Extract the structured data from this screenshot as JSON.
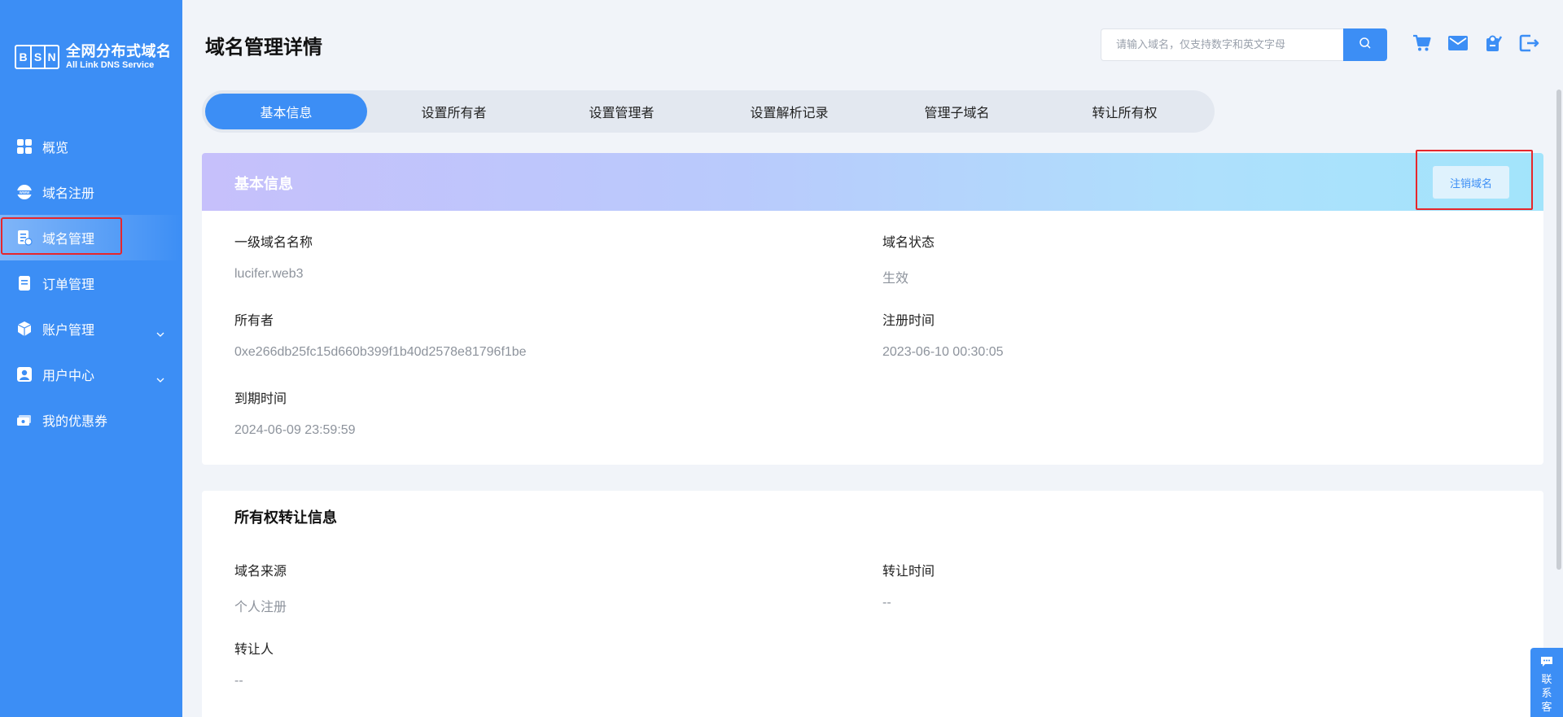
{
  "app": {
    "logo_letters": [
      "B",
      "S",
      "N"
    ],
    "logo_cn": "全网分布式域名",
    "logo_en": "All Link DNS Service"
  },
  "sidebar": {
    "items": [
      {
        "label": "概览",
        "icon": "grid-icon",
        "active": false
      },
      {
        "label": "域名注册",
        "icon": "www-icon",
        "active": false
      },
      {
        "label": "域名管理",
        "icon": "domain-manage-icon",
        "active": true
      },
      {
        "label": "订单管理",
        "icon": "order-icon",
        "active": false
      },
      {
        "label": "账户管理",
        "icon": "account-icon",
        "active": false,
        "expandable": true
      },
      {
        "label": "用户中心",
        "icon": "user-icon",
        "active": false,
        "expandable": true
      },
      {
        "label": "我的优惠券",
        "icon": "coupon-icon",
        "active": false
      }
    ]
  },
  "header": {
    "title": "域名管理详情",
    "search_placeholder": "请输入域名，仅支持数字和英文字母",
    "icons": [
      "cart-icon",
      "mail-icon",
      "certificate-icon",
      "logout-icon"
    ]
  },
  "tabs": [
    {
      "label": "基本信息",
      "active": true
    },
    {
      "label": "设置所有者",
      "active": false
    },
    {
      "label": "设置管理者",
      "active": false
    },
    {
      "label": "设置解析记录",
      "active": false
    },
    {
      "label": "管理子域名",
      "active": false
    },
    {
      "label": "转让所有权",
      "active": false
    }
  ],
  "basic_info": {
    "title": "基本信息",
    "cancel_button": "注销域名",
    "domain_name_label": "一级域名名称",
    "domain_name": "lucifer.web3",
    "status_label": "域名状态",
    "status": "生效",
    "owner_label": "所有者",
    "owner": "0xe266db25fc15d660b399f1b40d2578e81796f1be",
    "register_time_label": "注册时间",
    "register_time": "2023-06-10 00:30:05",
    "expire_time_label": "到期时间",
    "expire_time": "2024-06-09 23:59:59"
  },
  "transfer_info": {
    "title": "所有权转让信息",
    "source_label": "域名来源",
    "source": "个人注册",
    "transfer_time_label": "转让时间",
    "transfer_time": "--",
    "transferor_label": "转让人",
    "transferor": "--"
  },
  "contact": {
    "label": "联系客"
  },
  "colors": {
    "primary": "#3c8ef5",
    "highlight_border": "#e6262b",
    "muted_text": "#8d939c"
  }
}
